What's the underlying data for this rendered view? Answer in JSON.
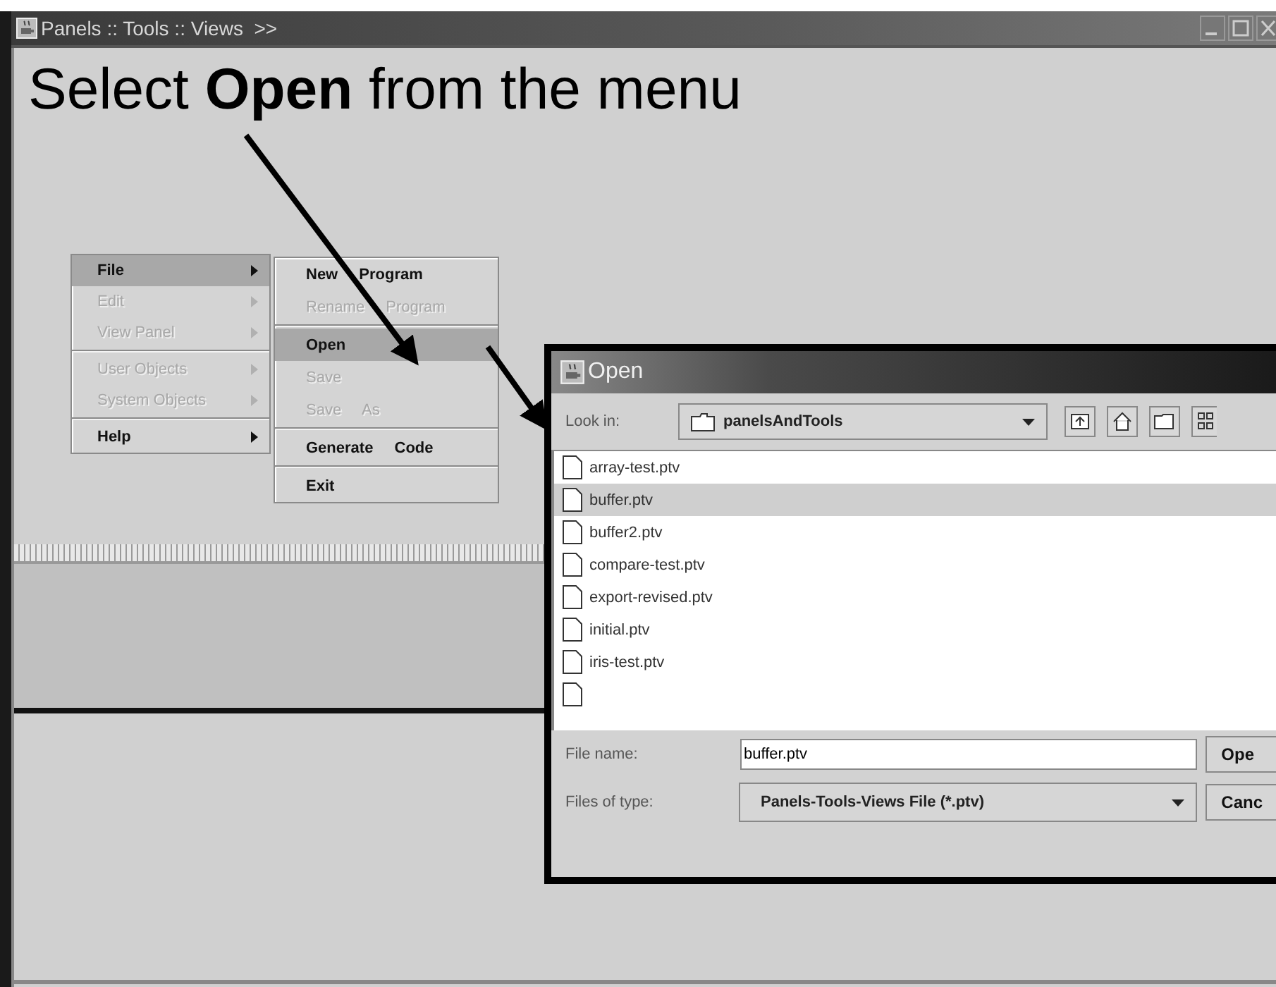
{
  "window": {
    "title": "Panels :: Tools :: Views  >>"
  },
  "instruction": "Select **Open** from the menu",
  "menu": [
    [
      {
        "label": "File",
        "selected": true,
        "disabled": false,
        "submenu": true
      },
      {
        "label": "Edit",
        "selected": false,
        "disabled": true,
        "submenu": true
      },
      {
        "label": "View Panel",
        "selected": false,
        "disabled": true,
        "submenu": true
      }
    ],
    [
      {
        "label": "User Objects",
        "selected": false,
        "disabled": true,
        "submenu": true
      },
      {
        "label": "System Objects",
        "selected": false,
        "disabled": true,
        "submenu": true
      }
    ],
    [
      {
        "label": "Help",
        "selected": false,
        "disabled": false,
        "submenu": true
      }
    ]
  ],
  "file_menu": [
    [
      {
        "label": "New Program",
        "selected": false,
        "disabled": false
      },
      {
        "label": "Rename Program",
        "selected": false,
        "disabled": true
      }
    ],
    [
      {
        "label": "Open",
        "selected": true,
        "disabled": false
      },
      {
        "label": "Save",
        "selected": false,
        "disabled": true
      },
      {
        "label": "Save As",
        "selected": false,
        "disabled": true
      }
    ],
    [
      {
        "label": "Generate Code",
        "selected": false,
        "disabled": false
      }
    ],
    [
      {
        "label": "Exit",
        "selected": false,
        "disabled": false
      }
    ]
  ],
  "dialog": {
    "title": "Open",
    "look_in_label": "Look in:",
    "look_in_value": "panelsAndTools",
    "files": [
      {
        "name": "array-test.ptv",
        "selected": false
      },
      {
        "name": "buffer.ptv",
        "selected": true
      },
      {
        "name": "buffer2.ptv",
        "selected": false
      },
      {
        "name": "compare-test.ptv",
        "selected": false
      },
      {
        "name": "export-revised.ptv",
        "selected": false
      },
      {
        "name": "initial.ptv",
        "selected": false
      },
      {
        "name": "iris-test.ptv",
        "selected": false
      }
    ],
    "file_name_label": "File name:",
    "file_name_value": "buffer.ptv",
    "file_type_label": "Files of type:",
    "file_type_value": "Panels-Tools-Views File (*.ptv)",
    "buttons": [
      "Ope",
      "Canc"
    ]
  }
}
